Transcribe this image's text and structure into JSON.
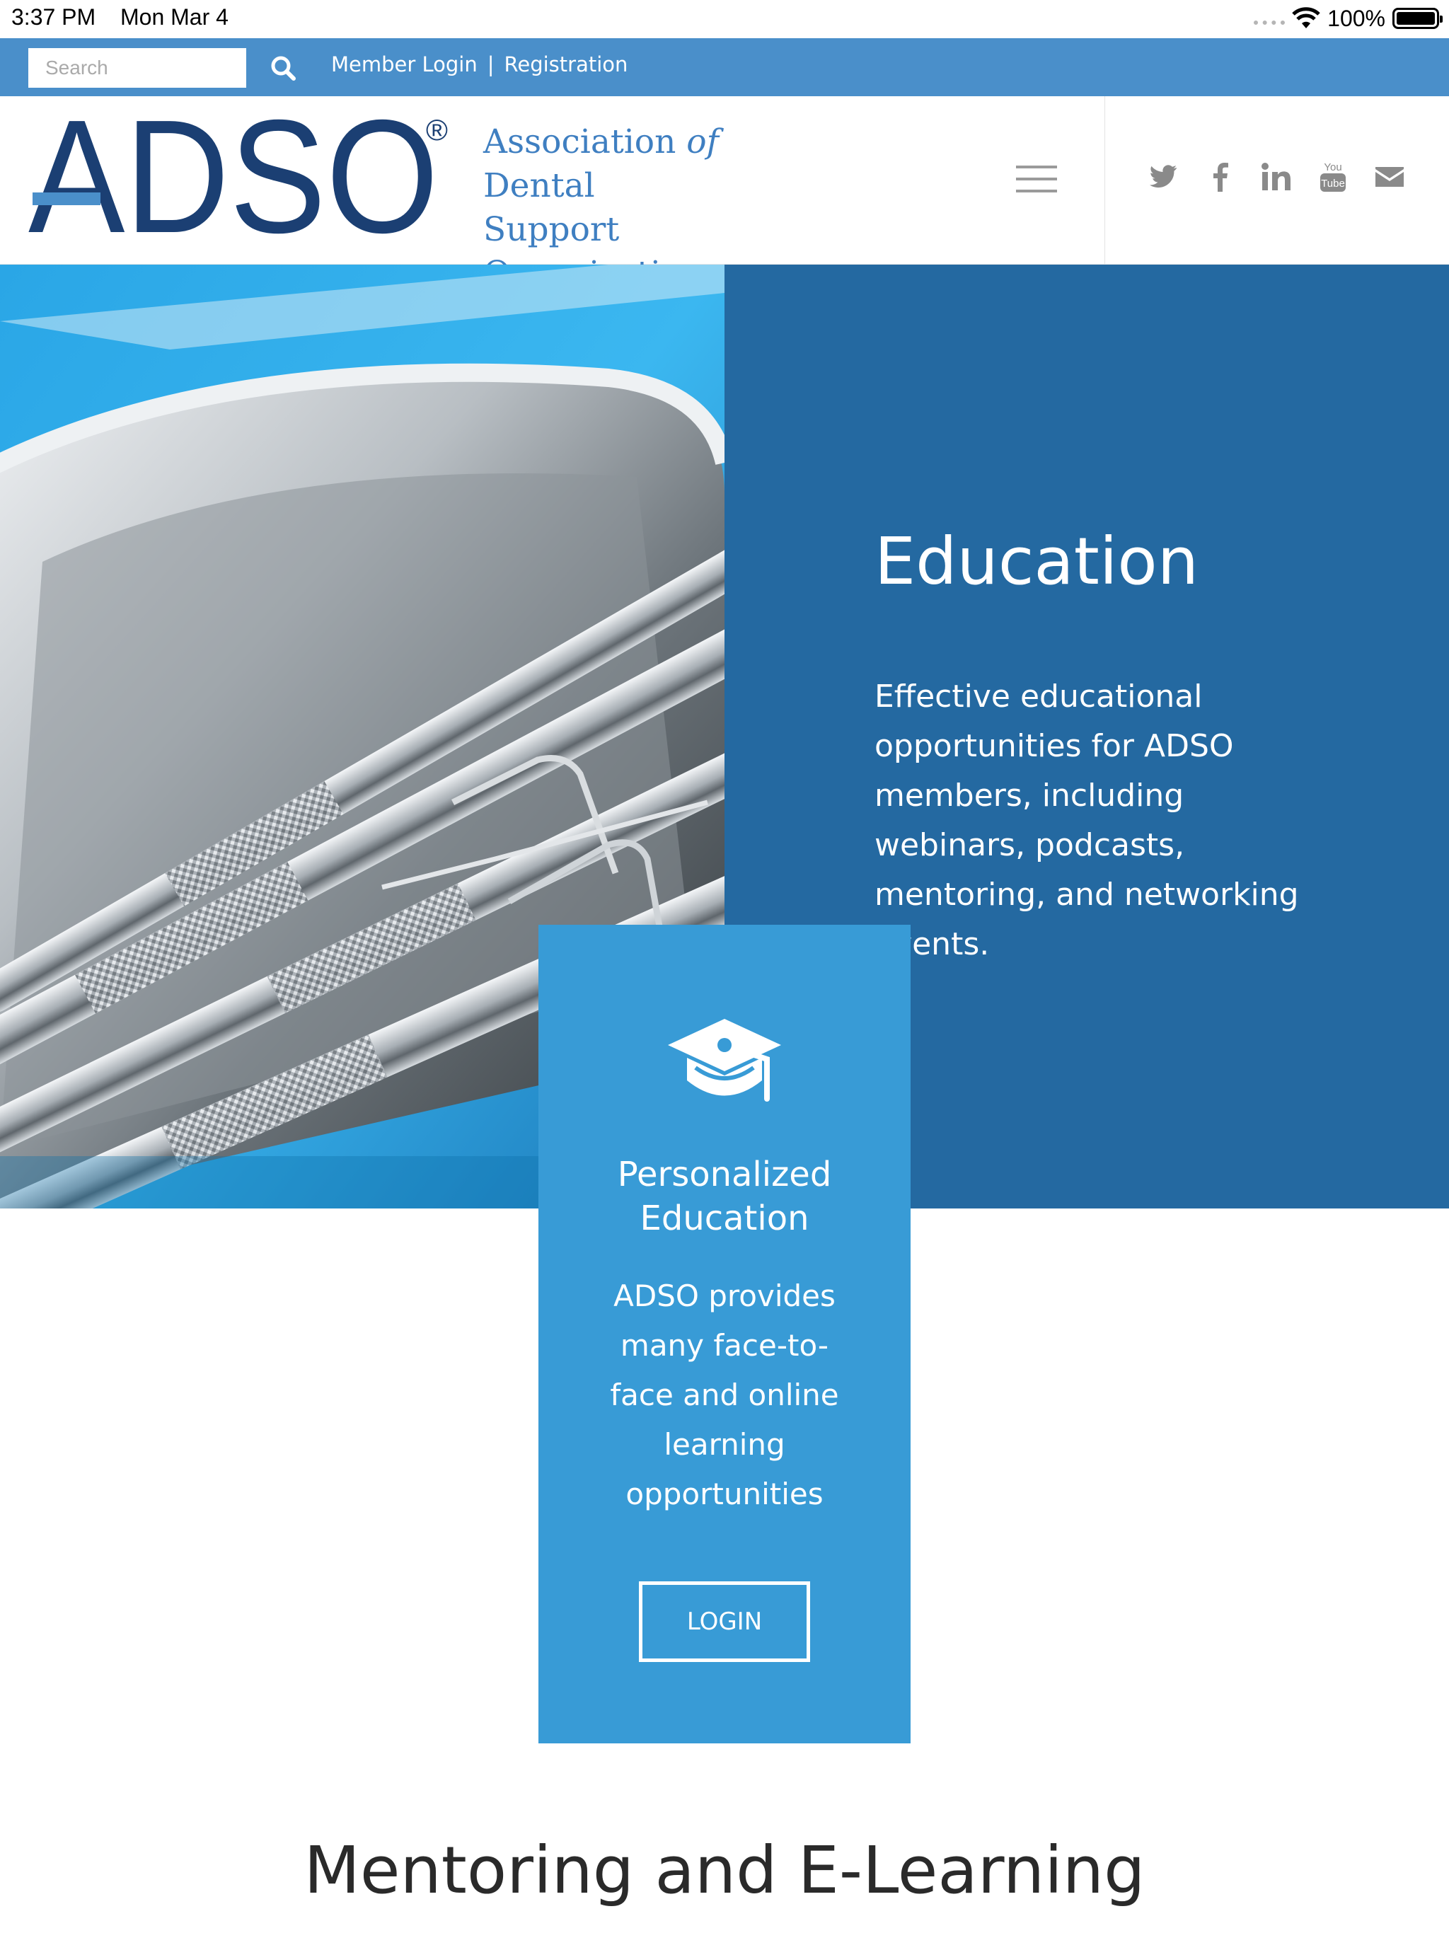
{
  "status_bar": {
    "time": "3:37 PM",
    "date": "Mon Mar 4",
    "battery": "100%"
  },
  "topbar": {
    "search": {
      "placeholder": "Search",
      "value": ""
    },
    "member_login": "Member Login",
    "separator": "|",
    "registration": "Registration"
  },
  "header": {
    "logo_text": "ADSO",
    "logo_registered": "®",
    "tagline": {
      "line1_a": "Association",
      "line1_b": "of",
      "line2": "Dental Support",
      "line3": "Organizations"
    },
    "socials": [
      "twitter-icon",
      "facebook-icon",
      "linkedin-icon",
      "youtube-icon",
      "mail-icon"
    ]
  },
  "hero": {
    "title": "Education",
    "text": "Effective educational opportunities for ADSO members, including webinars, podcasts, mentoring, and networking events."
  },
  "card": {
    "icon": "graduation-cap-icon",
    "title": "Personalized Education",
    "text": "ADSO provides many face-to-face and online learning opportunities",
    "button": "LOGIN"
  },
  "section": {
    "title": "Mentoring and E-Learning"
  },
  "colors": {
    "topbar": "#4a8fca",
    "logo_navy": "#1b3f73",
    "logo_blue": "#3f7fc1",
    "hero_panel": "#2469a1",
    "card": "#389bd6"
  }
}
